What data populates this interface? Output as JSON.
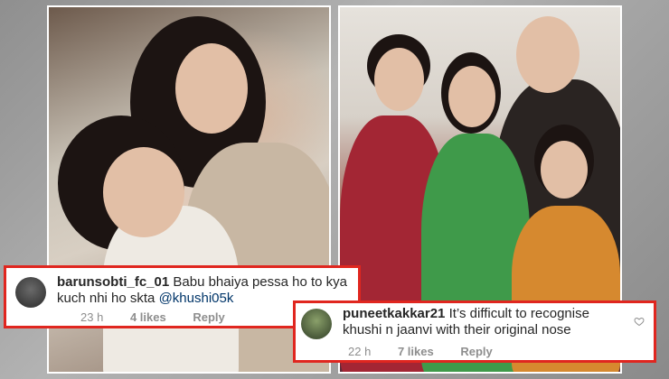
{
  "comments": [
    {
      "username": "barunsobti_fc_01",
      "text": "Babu bhaiya pessa ho to kya kuch nhi ho skta",
      "mention": "@khushi05k",
      "time": "23 h",
      "likes": "4 likes",
      "reply": "Reply"
    },
    {
      "username": "puneetkakkar21",
      "text": "It’s difficult to recognise khushi n jaanvi with their original nose",
      "time": "22 h",
      "likes": "7 likes",
      "reply": "Reply"
    }
  ],
  "colors": {
    "highlight_border": "#e0261f",
    "meta_text": "#8e8e8e",
    "mention": "#003569"
  },
  "icons": {
    "like": "heart-icon"
  }
}
